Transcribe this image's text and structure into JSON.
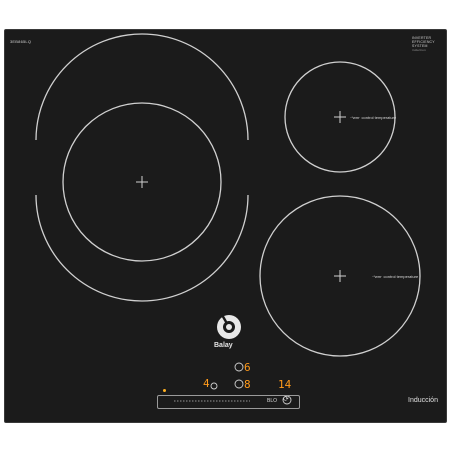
{
  "header": {
    "model_code": "3EB865LQ",
    "badge_lines": [
      "INVERTER",
      "EFFICIENCY",
      "SYSTEM"
    ],
    "badge_sub": "induction"
  },
  "zones": {
    "right_top": {
      "label": "·*wm· control temperature"
    },
    "right_bottom": {
      "label": "·*wm· control temperature"
    }
  },
  "brand": {
    "name": "Balay"
  },
  "footer": {
    "label": "Inducción"
  },
  "display": {
    "top_right_digit": "6",
    "left_digit": "4",
    "center_digit": "8",
    "right_digits": "14"
  },
  "controls": {
    "slider_label": "BLO",
    "timer_symbol": "⟳"
  },
  "colors": {
    "glass": "#1b1b1b",
    "ring": "#d0d0d0",
    "led": "#ff9a1a"
  }
}
